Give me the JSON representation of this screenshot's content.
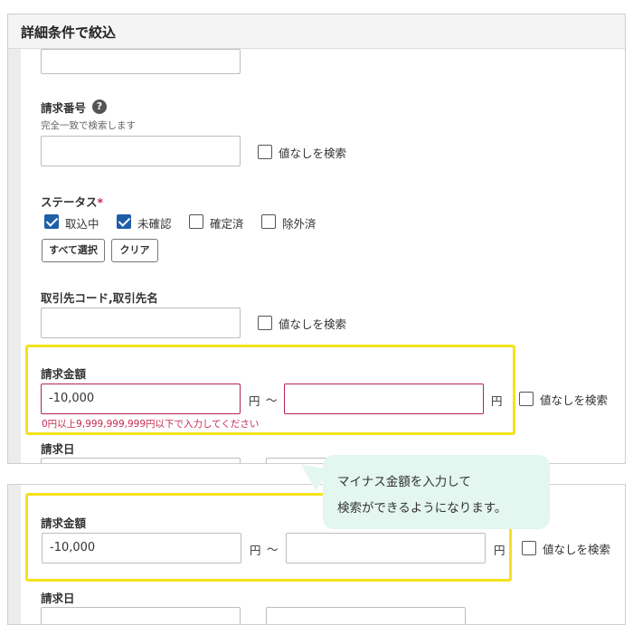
{
  "panel": {
    "title": "詳細条件で絞込",
    "invoice_no": {
      "label": "請求番号",
      "help": "?",
      "sub": "完全一致で検索します",
      "value": "",
      "no_value": "値なしを検索"
    },
    "status": {
      "label": "ステータス",
      "required": "*",
      "options": [
        {
          "label": "取込中",
          "checked": true
        },
        {
          "label": "未確認",
          "checked": true
        },
        {
          "label": "確定済",
          "checked": false
        },
        {
          "label": "除外済",
          "checked": false
        }
      ],
      "select_all": "すべて選択",
      "clear": "クリア"
    },
    "partner": {
      "label": "取引先コード,取引先名",
      "value": "",
      "no_value": "値なしを検索"
    },
    "amount": {
      "label": "請求金額",
      "from_value": "-10,000",
      "unit_from": "円",
      "tilde": "～",
      "to_value": "",
      "unit_to": "円",
      "no_value": "値なしを検索",
      "error": "0円以上9,999,999,999円以下で入力してください"
    },
    "date": {
      "label": "請求日"
    }
  },
  "panel2": {
    "amount": {
      "label": "請求金額",
      "from_value": "-10,000",
      "unit_from": "円",
      "tilde": "～",
      "to_value": "",
      "unit_to": "円",
      "no_value": "値なしを検索"
    },
    "date": {
      "label": "請求日"
    }
  },
  "callout": {
    "line1": "マイナス金額を入力して",
    "line2": "検索ができるようになります。"
  },
  "colors": {
    "highlight": "#f5e21c",
    "error": "#c62a50",
    "checkbox_on": "#1f5fa8",
    "callout_bg": "#e3f6ef"
  }
}
